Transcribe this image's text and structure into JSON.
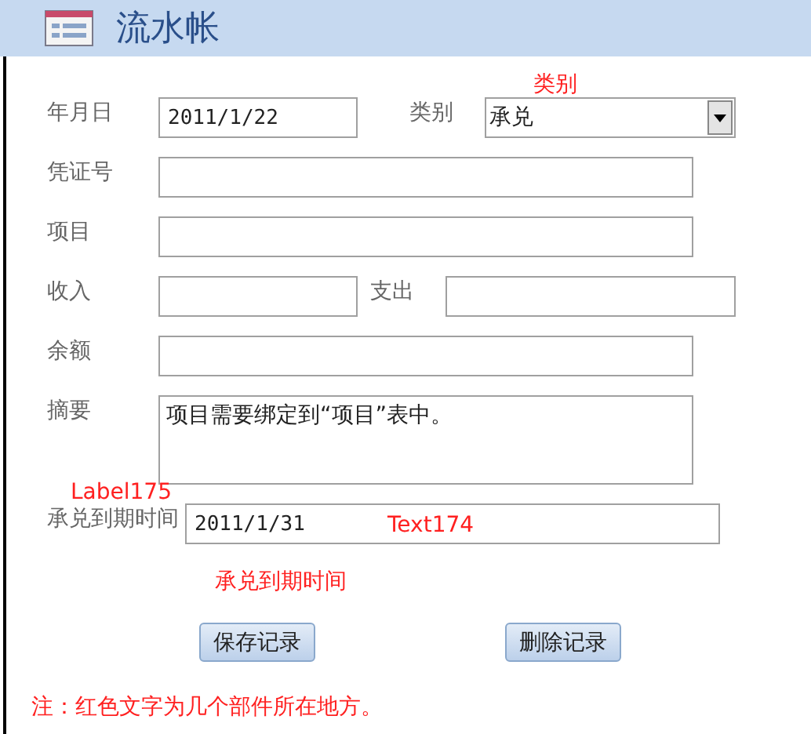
{
  "title": "流水帐",
  "rows": [
    {
      "fields": [
        {
          "label": "年月日",
          "kind": "text",
          "value": "2011/1/22"
        },
        {
          "label": "类别",
          "kind": "dropdown",
          "value": "承兑"
        }
      ]
    },
    {
      "fields": [
        {
          "label": "凭证号",
          "kind": "text"
        }
      ]
    },
    {
      "fields": [
        {
          "label": "项目",
          "kind": "text"
        }
      ]
    },
    {
      "fields": [
        {
          "label": "收入",
          "kind": "text"
        },
        {
          "label": "支出",
          "kind": "text"
        }
      ]
    },
    {
      "fields": [
        {
          "label": "余额",
          "kind": "text"
        }
      ]
    },
    {
      "fields": [
        {
          "label": "摘要",
          "kind": "memo",
          "value": "项目需要绑定到“项目”表中。"
        }
      ]
    },
    {
      "fields": [
        {
          "label": "承兑到期时间",
          "kind": "text",
          "value": "2011/1/31"
        }
      ]
    }
  ],
  "buttons": [
    "保存记录",
    "删除记录"
  ],
  "annotations": [
    "类别",
    "Label175",
    "Text174",
    "承兑到期时间"
  ],
  "note": "注：红色文字为几个部件所在地方。"
}
